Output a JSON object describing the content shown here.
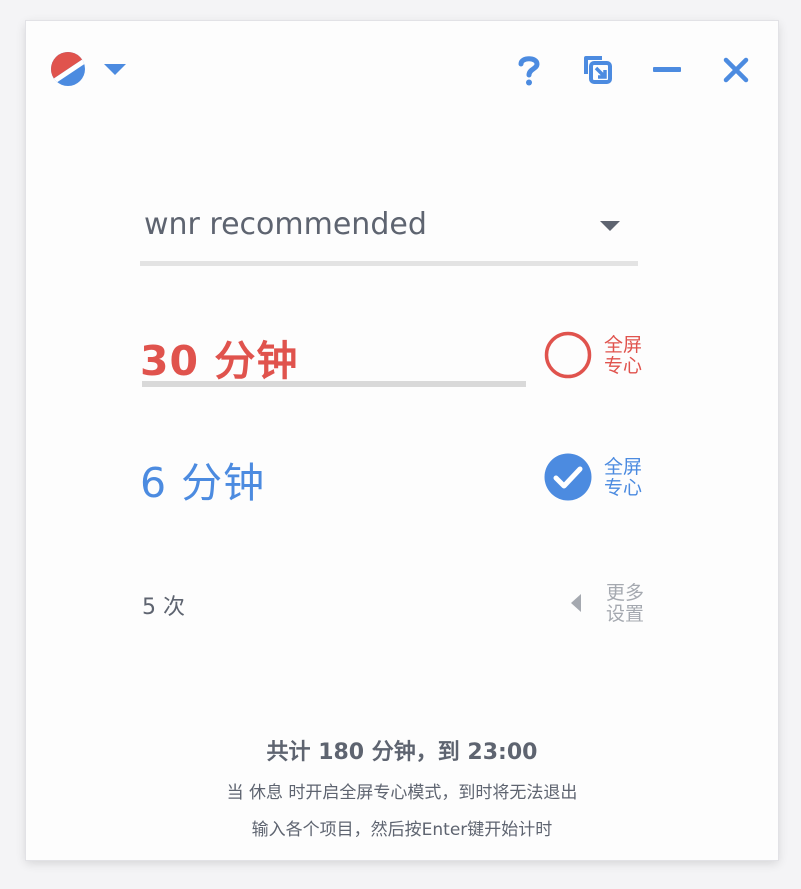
{
  "colors": {
    "red": "#e0534d",
    "blue": "#4c8be0",
    "text_gray": "#5e6470",
    "muted_gray": "#a5a9b0"
  },
  "titlebar": {
    "logo_icon": "split-circle-logo-icon",
    "menu_icon": "caret-down-icon",
    "help_icon": "question-mark-icon",
    "window_mode_icon": "window-resize-icon",
    "minimize_icon": "minimize-icon",
    "close_icon": "close-icon"
  },
  "preset": {
    "value": "wnr recommended",
    "dropdown_icon": "caret-down-icon"
  },
  "work": {
    "value": "30 分钟",
    "fullscreen_label_line1": "全屏",
    "fullscreen_label_line2": "专心",
    "fullscreen_checked": false
  },
  "rest": {
    "value": "6 分钟",
    "fullscreen_label_line1": "全屏",
    "fullscreen_label_line2": "专心",
    "fullscreen_checked": true
  },
  "loops": {
    "value": "5 次"
  },
  "more_settings": {
    "label_line1": "更多",
    "label_line2": "设置",
    "icon": "caret-left-icon"
  },
  "summary": {
    "total": "共计 180 分钟，到 23:00",
    "notice": "当 休息 时开启全屏专心模式，到时将无法退出",
    "hint": "输入各个项目，然后按Enter键开始计时"
  }
}
